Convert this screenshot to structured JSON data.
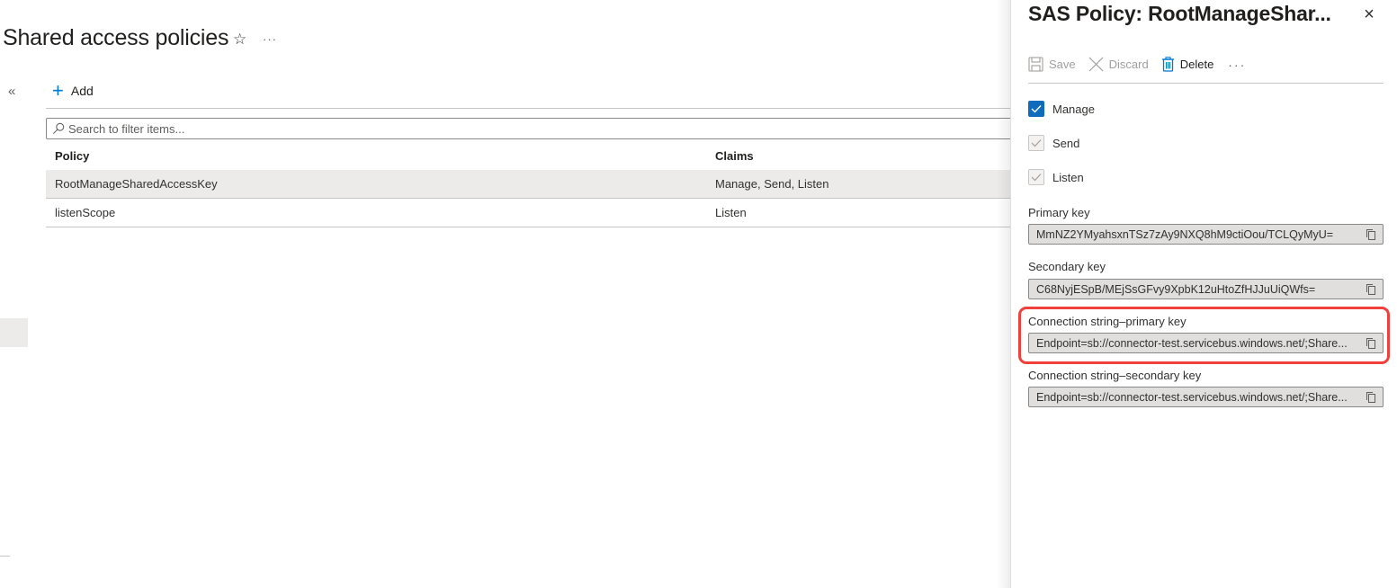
{
  "page": {
    "title": "Shared access policies",
    "favorite_icon": "star-icon",
    "more_label": "···",
    "collapse_label": "«"
  },
  "toolbar": {
    "add_label": "Add"
  },
  "search": {
    "placeholder": "Search to filter items...",
    "value": ""
  },
  "table": {
    "columns": [
      "Policy",
      "Claims"
    ],
    "rows": [
      {
        "policy": "RootManageSharedAccessKey",
        "claims": "Manage, Send, Listen",
        "selected": true
      },
      {
        "policy": "listenScope",
        "claims": "Listen",
        "selected": false
      }
    ]
  },
  "panel": {
    "title": "SAS Policy: RootManageShar...",
    "close_label": "×",
    "commands": {
      "save": "Save",
      "discard": "Discard",
      "delete": "Delete",
      "more": "···"
    },
    "claims": [
      {
        "label": "Manage",
        "checked": true,
        "disabled": false
      },
      {
        "label": "Send",
        "checked": true,
        "disabled": true
      },
      {
        "label": "Listen",
        "checked": true,
        "disabled": true
      }
    ],
    "fields": [
      {
        "label": "Primary key",
        "value": "MmNZ2YMyahsxnTSz7zAy9NXQ8hM9ctiOou/TCLQyMyU="
      },
      {
        "label": "Secondary key",
        "value": "C68NyjESpB/MEjSsGFvy9XpbK12uHtoZfHJJuUiQWfs="
      },
      {
        "label": "Connection string–primary key",
        "value": "Endpoint=sb://connector-test.servicebus.windows.net/;Share..."
      },
      {
        "label": "Connection string–secondary key",
        "value": "Endpoint=sb://connector-test.servicebus.windows.net/;Share..."
      }
    ],
    "highlighted_field": "Connection string–primary key"
  },
  "colors": {
    "accent": "#0078d4",
    "checkbox_checked": "#0f6cbd",
    "highlight_annotation": "#f0403c",
    "selected_row": "#edebe9"
  }
}
